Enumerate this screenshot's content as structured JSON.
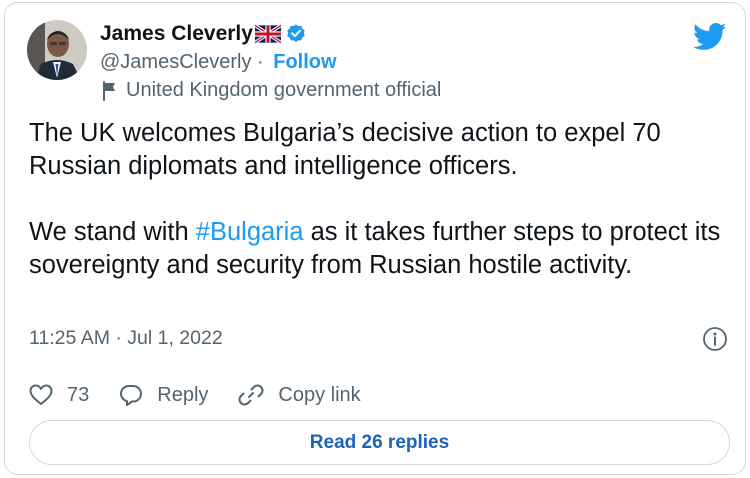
{
  "author": {
    "display_name": "James Cleverly",
    "handle": "@JamesCleverly",
    "separator": " · ",
    "follow_label": "Follow",
    "affiliation": "United Kingdom government official"
  },
  "tweet": {
    "line1": "The UK welcomes Bulgaria’s decisive action to expel 70 Russian diplomats and intelligence officers.",
    "line2_before": "We stand with ",
    "hashtag": "#Bulgaria",
    "line2_after": " as it takes further steps to protect its sovereignty and security from Russian hostile activity.",
    "timestamp": "11:25 AM · Jul 1, 2022"
  },
  "actions": {
    "like_count": "73",
    "reply_label": "Reply",
    "copy_label": "Copy link"
  },
  "read_replies_label": "Read 26 replies",
  "colors": {
    "accent": "#1d9bf0",
    "text": "#0f1419",
    "muted": "#536471",
    "border": "#cfd9de"
  },
  "icons": [
    "uk-flag-icon",
    "verified-badge-icon",
    "twitter-logo-icon",
    "flag-icon",
    "info-icon",
    "heart-icon",
    "reply-icon",
    "link-icon"
  ]
}
